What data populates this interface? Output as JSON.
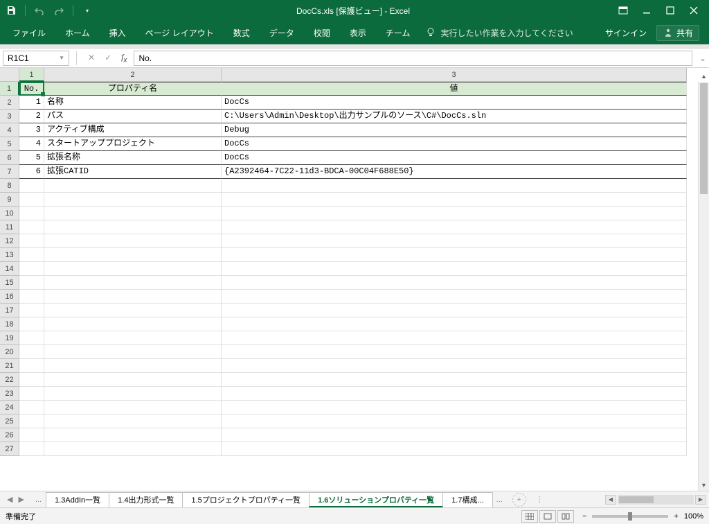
{
  "title_bar": {
    "title": "DocCs.xls [保護ビュー] - Excel"
  },
  "ribbon": {
    "tabs": [
      "ファイル",
      "ホーム",
      "挿入",
      "ページ レイアウト",
      "数式",
      "データ",
      "校閲",
      "表示",
      "チーム"
    ],
    "tell_me": "実行したい作業を入力してください",
    "sign_in": "サインイン",
    "share": "共有"
  },
  "formula_bar": {
    "name_box": "R1C1",
    "formula": "No."
  },
  "columns": [
    "1",
    "2",
    "3"
  ],
  "headers": {
    "c1": "No.",
    "c2": "プロパティ名",
    "c3": "値"
  },
  "rows": [
    {
      "no": "1",
      "name": "名称",
      "value": "DocCs"
    },
    {
      "no": "2",
      "name": "パス",
      "value": "C:\\Users\\Admin\\Desktop\\出力サンプルのソース\\C#\\DocCs.sln"
    },
    {
      "no": "3",
      "name": "アクティブ構成",
      "value": "Debug"
    },
    {
      "no": "4",
      "name": "スタートアッププロジェクト",
      "value": "DocCs"
    },
    {
      "no": "5",
      "name": "拡張名称",
      "value": "DocCs"
    },
    {
      "no": "6",
      "name": "拡張CATID",
      "value": "{A2392464-7C22-11d3-BDCA-00C04F688E50}"
    }
  ],
  "row_labels": [
    "1",
    "2",
    "3",
    "4",
    "5",
    "6",
    "7",
    "8",
    "9",
    "10",
    "11",
    "12",
    "13",
    "14",
    "15",
    "16",
    "17",
    "18",
    "19",
    "20",
    "21",
    "22",
    "23",
    "24",
    "25",
    "26",
    "27"
  ],
  "sheet_tabs": {
    "tabs": [
      "1.3AddIn一覧",
      "1.4出力形式一覧",
      "1.5プロジェクトプロパティ一覧",
      "1.6ソリューションプロパティ一覧",
      "1.7構成..."
    ],
    "active_index": 3,
    "ellipsis": "..."
  },
  "status_bar": {
    "ready": "準備完了",
    "zoom": "100%"
  }
}
